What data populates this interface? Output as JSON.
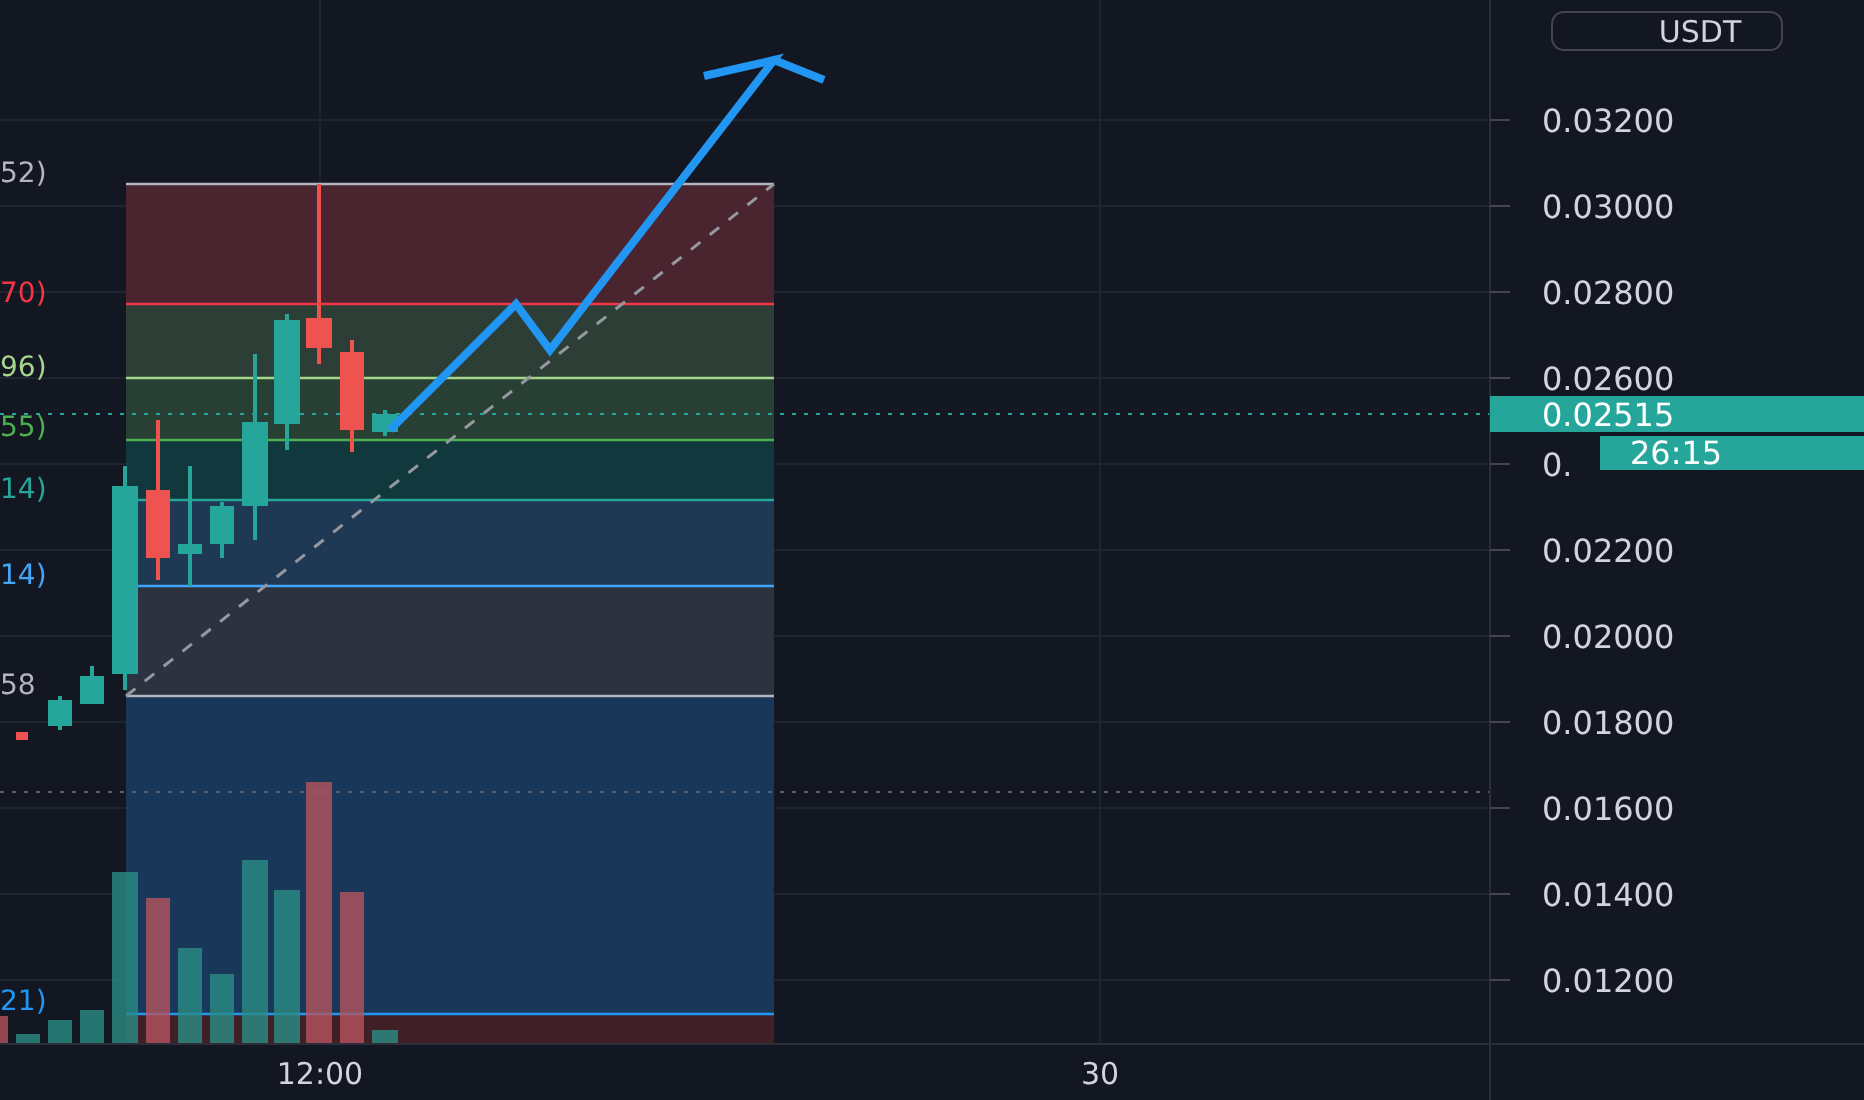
{
  "chart": {
    "currency": "USDT",
    "price_axis": [
      "0.03200",
      "0.03000",
      "0.02800",
      "0.02600",
      "0.",
      "0.02200",
      "0.02000",
      "0.01800",
      "0.01600",
      "0.01400",
      "0.01200"
    ],
    "time_axis": [
      "12:00",
      "30"
    ],
    "last_price": "0.02515",
    "countdown": "26:15",
    "fib_labels": [
      {
        "text": "52)",
        "color": "#b2b5be"
      },
      {
        "text": "70)",
        "color": "#f23645"
      },
      {
        "text": "96)",
        "color": "#a5d68b"
      },
      {
        "text": "55)",
        "color": "#4caf50"
      },
      {
        "text": "14)",
        "color": "#26a69a"
      },
      {
        "text": "14)",
        "color": "#42a5f5"
      },
      {
        "text": "58",
        "color": "#b2b5be"
      },
      {
        "text": "21)",
        "color": "#2196f3"
      }
    ]
  }
}
